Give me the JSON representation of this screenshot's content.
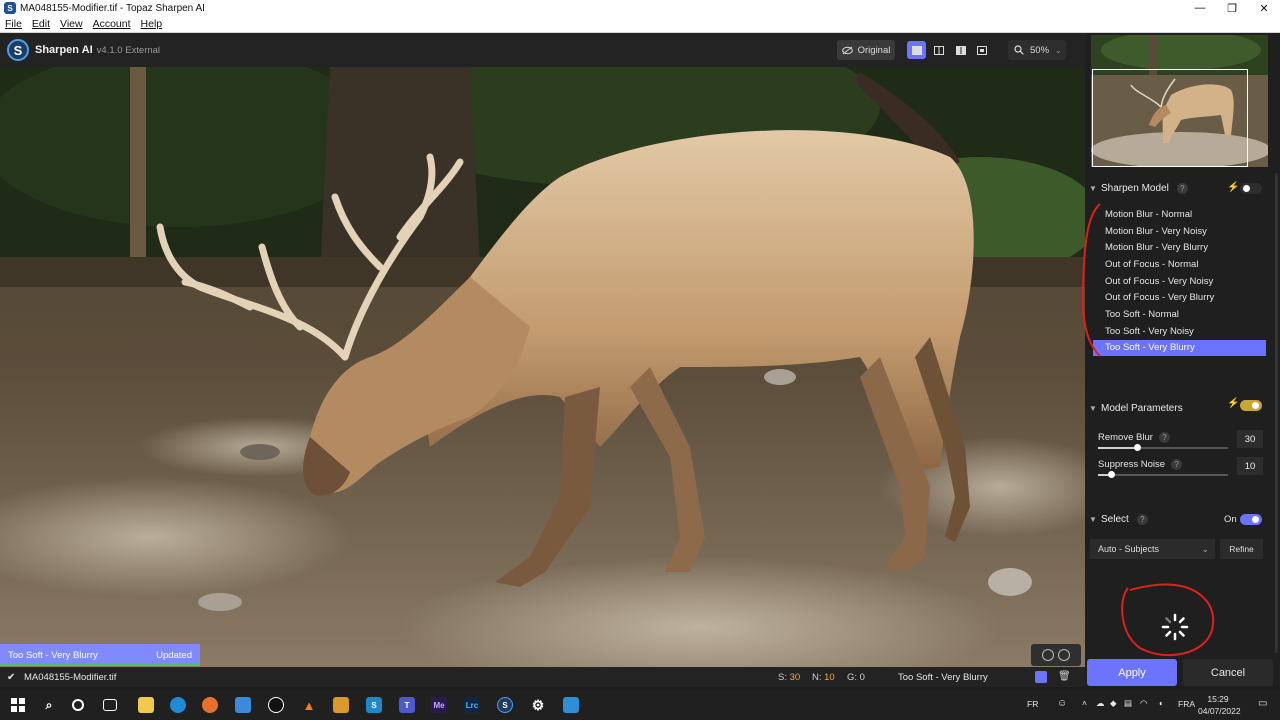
{
  "window": {
    "title": "MA048155-Modifier.tif - Topaz Sharpen AI",
    "controls": [
      "—",
      "❐",
      "✕"
    ]
  },
  "menu": [
    "File",
    "Edit",
    "View",
    "Account",
    "Help"
  ],
  "header": {
    "app_name": "Sharpen AI",
    "version": "v4.1.0 External",
    "original_label": "Original",
    "zoom": "50%"
  },
  "image_overlay": {
    "model_label": "Too Soft - Very Blurry",
    "status": "Updated"
  },
  "panel": {
    "sharpen_model": {
      "title": "Sharpen Model",
      "items": [
        "Motion Blur - Normal",
        "Motion Blur - Very Noisy",
        "Motion Blur - Very Blurry",
        "Out of Focus - Normal",
        "Out of Focus - Very Noisy",
        "Out of Focus - Very Blurry",
        "Too Soft - Normal",
        "Too Soft - Very Noisy",
        "Too Soft - Very Blurry"
      ],
      "selected_index": 8
    },
    "model_parameters": {
      "title": "Model Parameters",
      "remove_blur": {
        "label": "Remove Blur",
        "value": "30",
        "fraction": 0.3
      },
      "suppress_noise": {
        "label": "Suppress Noise",
        "value": "10",
        "fraction": 0.1
      }
    },
    "select": {
      "title": "Select",
      "state": "On",
      "mode": "Auto - Subjects",
      "refine_label": "Refine"
    }
  },
  "bottom_bar": {
    "filename": "MA048155-Modifier.tif",
    "s_label": "S:",
    "s_value": "30",
    "n_label": "N:",
    "n_value": "10",
    "g_label": "G:",
    "g_value": "0",
    "model": "Too Soft - Very Blurry"
  },
  "actions": {
    "apply": "Apply",
    "cancel": "Cancel"
  },
  "taskbar": {
    "lang_left": "FR",
    "lang_right": "FRA",
    "time": "15:29",
    "date": "04/07/2022",
    "app_labels": {
      "me": "Me",
      "lrc": "Lrc"
    }
  },
  "colors": {
    "accent": "#6b73ff",
    "annotation": "#e0201c",
    "stat_value": "#f2a93b"
  }
}
